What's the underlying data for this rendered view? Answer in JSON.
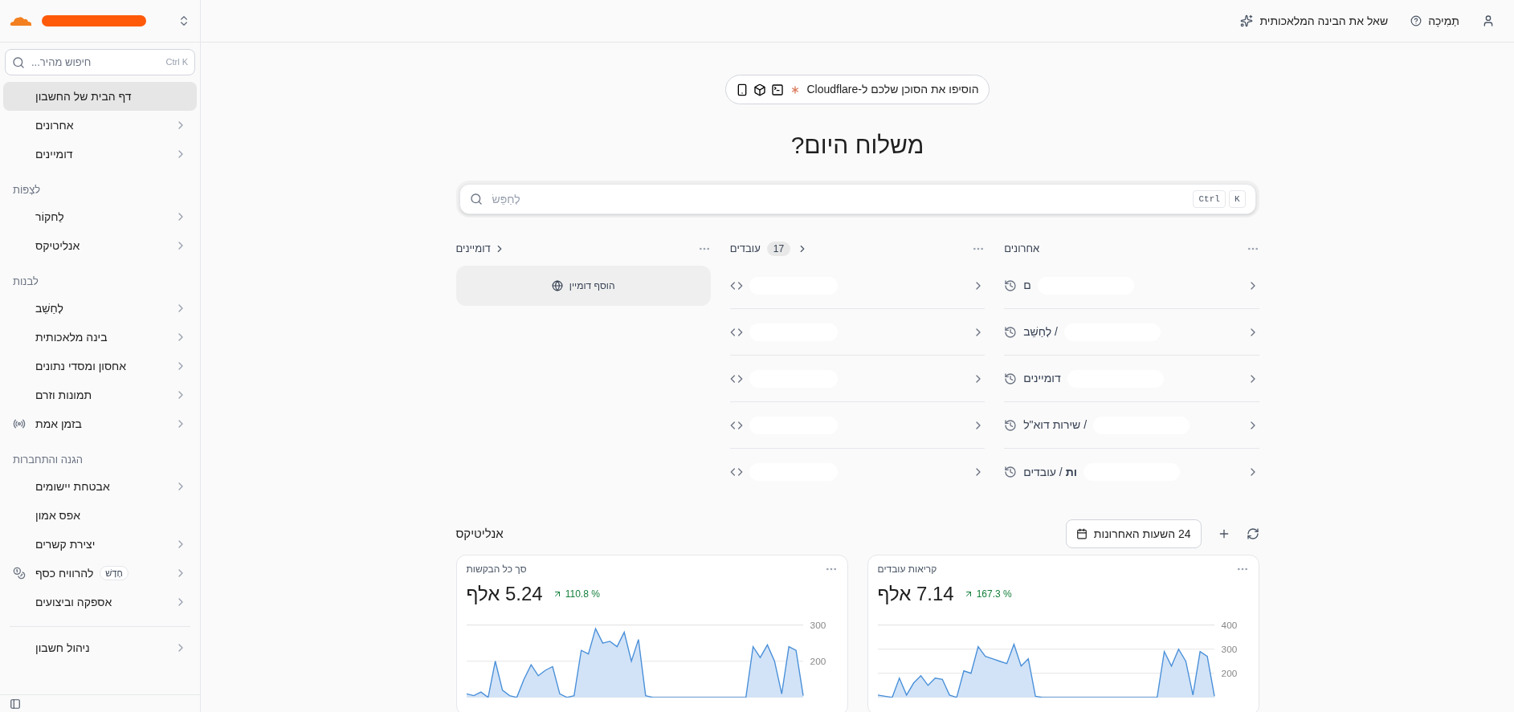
{
  "sidebar": {
    "account": {
      "redacted": true
    },
    "search": {
      "placeholder": "חיפוש מהיר...",
      "shortcut": "Ctrl K"
    },
    "sections": [
      {
        "items": [
          {
            "label": "דף הבית של החשבון",
            "selected": true,
            "chevron": false,
            "kind": "plain"
          },
          {
            "label": "אחרונים",
            "selected": false,
            "chevron": true,
            "kind": "plain"
          },
          {
            "label": "דומיינים",
            "selected": false,
            "chevron": true,
            "kind": "plain"
          }
        ]
      },
      {
        "title": "לצְפּוֹת",
        "items": [
          {
            "label": "לַחקוֹר",
            "selected": false,
            "chevron": true,
            "kind": "plain"
          },
          {
            "label": "אנליטיקס",
            "selected": false,
            "chevron": true,
            "kind": "plain"
          }
        ]
      },
      {
        "title": "לבנות",
        "items": [
          {
            "label": "לְחַשֵׁב",
            "selected": false,
            "chevron": true,
            "kind": "plain"
          },
          {
            "label": "בינה מלאכותית",
            "selected": false,
            "chevron": true,
            "kind": "plain"
          },
          {
            "label": "אחסון ומסדי נתונים",
            "selected": false,
            "chevron": true,
            "kind": "plain"
          },
          {
            "label": "תמונות וזרם",
            "selected": false,
            "chevron": true,
            "kind": "plain"
          },
          {
            "label": "בזמן אמת",
            "selected": false,
            "chevron": true,
            "kind": "broadcast"
          }
        ]
      },
      {
        "title": "הגנה והתחברות",
        "items": [
          {
            "label": "אבטחת יישומים",
            "selected": false,
            "chevron": true,
            "kind": "plain"
          },
          {
            "label": "אפס אמון",
            "selected": false,
            "chevron": false,
            "kind": "plain"
          },
          {
            "label": "יצירת קשרים",
            "selected": false,
            "chevron": true,
            "kind": "plain"
          },
          {
            "label": "להרוויח כסף",
            "selected": false,
            "chevron": true,
            "kind": "coins",
            "badge": "חָדָשׁ"
          },
          {
            "label": "אספקה וביצועים",
            "selected": false,
            "chevron": true,
            "kind": "plain"
          }
        ]
      }
    ],
    "footer_items": [
      {
        "label": "ניהול חשבון",
        "selected": false,
        "chevron": true
      }
    ]
  },
  "top_bar": {
    "actions": [
      {
        "label": "תְמִיכָה",
        "kind": "help"
      },
      {
        "label": "שאל את הבינה המלאכותית",
        "kind": "ai"
      }
    ]
  },
  "agent_banner": "הוסיפו את הסוכן שלכם ל-Cloudflare",
  "heading": "משלוח היום?",
  "search": {
    "placeholder": "לְחַפֵּשׂ",
    "keys": [
      "K",
      "Ctrl"
    ]
  },
  "recent": {
    "title": "אחרונים",
    "rows": [
      {
        "text": "ם",
        "redacted": true
      },
      {
        "text": "/ לְחַשֵׁב",
        "redacted": true
      },
      {
        "text": "דומיינים",
        "redacted": true
      },
      {
        "text": "/ שירות דוא\"ל",
        "redacted": true
      },
      {
        "text": "**ות** / עובדים",
        "redacted": true
      }
    ]
  },
  "workers": {
    "title": "עובדים",
    "count": "17",
    "rows": [
      {
        "redacted": true
      },
      {
        "redacted": true
      },
      {
        "redacted": true
      },
      {
        "redacted": true
      },
      {
        "redacted": true
      }
    ]
  },
  "domains": {
    "title": "דומיינים",
    "add_button": "הוסף דומיין"
  },
  "analytics": {
    "title": "אנליטיקס",
    "range": "24 השעות האחרונות",
    "cards": [
      {
        "title": "קריאות עובדים",
        "value": "7.14 אלף",
        "change": "167.3 %",
        "chart_data": {
          "type": "area",
          "ylim": [
            100,
            400
          ],
          "grid": true,
          "yticks": [
            200,
            300,
            400
          ],
          "series": [
            {
              "color": "#4a90d9",
              "values": [
                110,
                105,
                100,
                180,
                110,
                160,
                190,
                150,
                180,
                175,
                110,
                100,
                210,
                200,
                310,
                270,
                260,
                250,
                240,
                320,
                230,
                260,
                105,
                100,
                100,
                100,
                100,
                100,
                100,
                100,
                100,
                100,
                100,
                100,
                100,
                100,
                100,
                100,
                100,
                100,
                290,
                230,
                300,
                250,
                110,
                290,
                270,
                105
              ]
            }
          ]
        }
      },
      {
        "title": "סך כל הבקשות",
        "value": "5.24 אלף",
        "change": "110.8 %",
        "chart_data": {
          "type": "area",
          "ylim": [
            100,
            300
          ],
          "grid": true,
          "yticks": [
            200,
            300
          ],
          "series": [
            {
              "color": "#4a90d9",
              "values": [
                110,
                105,
                115,
                100,
                200,
                120,
                105,
                100,
                150,
                190,
                160,
                175,
                185,
                110,
                100,
                105,
                230,
                220,
                290,
                250,
                255,
                240,
                280,
                200,
                260,
                105,
                100,
                100,
                100,
                100,
                100,
                100,
                100,
                100,
                100,
                100,
                100,
                100,
                100,
                100,
                240,
                210,
                245,
                200,
                110,
                240,
                230,
                105
              ]
            }
          ]
        }
      }
    ]
  }
}
